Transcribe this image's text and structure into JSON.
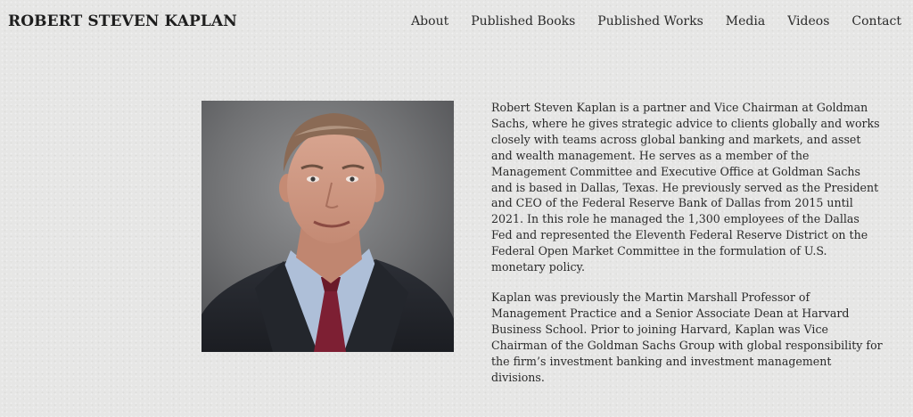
{
  "header": {
    "site_title": "ROBERT STEVEN KAPLAN",
    "nav": [
      {
        "label": "About"
      },
      {
        "label": "Published Books"
      },
      {
        "label": "Published Works"
      },
      {
        "label": "Media"
      },
      {
        "label": "Videos"
      },
      {
        "label": "Contact"
      }
    ]
  },
  "bio": {
    "paragraphs": [
      "Robert Steven Kaplan is a partner and Vice Chairman at Goldman Sachs, where he gives strategic advice to clients globally and works closely with teams across global banking and markets, and asset and wealth management. He serves as a member of the Management Committee and Executive Office at Goldman Sachs and is based in Dallas, Texas. He previously served as the President and CEO of the Federal Reserve Bank of Dallas from 2015 until 2021. In this role he managed the 1,300 employees of the Dallas Fed and represented the Eleventh Federal Reserve District on the Federal Open Market Committee in the formulation of U.S. monetary policy.",
      "Kaplan was previously the Martin Marshall Professor of Management Practice and a Senior Associate Dean at Harvard Business School. Prior to joining Harvard, Kaplan was Vice Chairman of the Goldman Sachs Group with global responsibility for the firm’s investment banking and investment management divisions."
    ]
  }
}
